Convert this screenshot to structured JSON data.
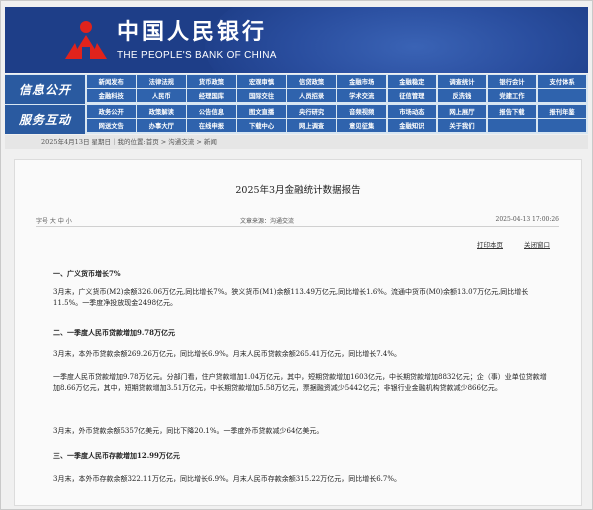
{
  "header": {
    "bank_name_cn": "中国人民银行",
    "bank_name_en": "THE PEOPLE'S BANK OF CHINA",
    "logo_icon": "pboc-emblem-icon"
  },
  "nav": {
    "section1_label": "信息公开",
    "section2_label": "服务互动",
    "section1_row1": [
      "新闻发布",
      "法律法规",
      "货币政策",
      "宏观审慎",
      "信贷政策",
      "金融市场",
      "金融稳定",
      "调查统计",
      "银行会计",
      "支付体系"
    ],
    "section1_row2": [
      "金融科技",
      "人民币",
      "经理国库",
      "国际交往",
      "人员招录",
      "学术交流",
      "征信管理",
      "反洗钱",
      "党建工作",
      ""
    ],
    "section2_row1": [
      "政务公开",
      "政策解读",
      "公告信息",
      "图文直播",
      "央行研究",
      "音频视频",
      "市场动态",
      "网上展厅",
      "报告下载",
      "报刊年鉴"
    ],
    "section2_row2": [
      "网送文告",
      "办事大厅",
      "在线申报",
      "下载中心",
      "网上调查",
      "意见征集",
      "金融知识",
      "关于我们",
      "",
      ""
    ]
  },
  "breadcrumb": "2025年4月13日 星期日｜我的位置:首页 > 沟通交流 > 新闻",
  "article": {
    "title": "2025年3月金融统计数据报告",
    "font_size_label": "字号 大 中 小",
    "source": "文章来源：沟通交流",
    "date": "2025-04-13 17:00:26",
    "print_link": "打印本页",
    "close_link": "关闭窗口",
    "paragraphs": [
      {
        "heading": true,
        "text": "一、广义货币增长7%"
      },
      {
        "heading": false,
        "text": "3月末，广义货币(M2)余额326.06万亿元,同比增长7%。狭义货币(M1)余额113.49万亿元,同比增长1.6%。流通中货币(M0)余额13.07万亿元,同比增长11.5%。一季度净投放现金2498亿元。"
      },
      {
        "heading": true,
        "text": "二、一季度人民币贷款增加9.78万亿元"
      },
      {
        "heading": false,
        "text": "3月末，本外币贷款余额269.26万亿元，同比增长6.9%。月末人民币贷款余额265.41万亿元，同比增长7.4%。"
      },
      {
        "heading": false,
        "text": "一季度人民币贷款增加9.78万亿元。分部门看，住户贷款增加1.04万亿元，其中，短期贷款增加1603亿元，中长期贷款增加8832亿元；企（事）业单位贷款增加8.66万亿元，其中，短期贷款增加3.51万亿元，中长期贷款增加5.58万亿元，票据融资减少5442亿元；非银行业金融机构贷款减少866亿元。"
      },
      {
        "heading": false,
        "text": "3月末，外币贷款余额5357亿美元，同比下降20.1%。一季度外币贷款减少64亿美元。"
      },
      {
        "heading": true,
        "text": "三、一季度人民币存款增加12.99万亿元"
      },
      {
        "heading": false,
        "text": "3月末，本外币存款余额322.11万亿元，同比增长6.9%。月末人民币存款余额315.22万亿元，同比增长6.7%。"
      }
    ]
  }
}
